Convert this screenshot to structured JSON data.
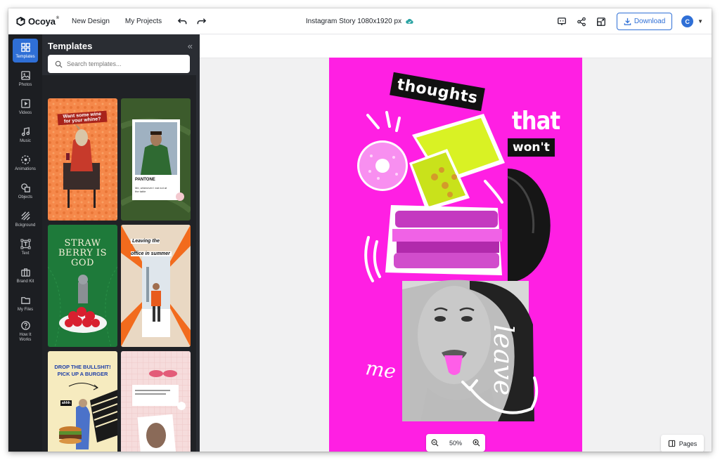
{
  "app": {
    "name": "Ocoya",
    "reg_mark": "®"
  },
  "header": {
    "nav": [
      "New Design",
      "My Projects"
    ],
    "document_title": "Instagram Story 1080x1920 px",
    "download_label": "Download",
    "avatar_initial": "C"
  },
  "rail": {
    "items": [
      {
        "label": "Templates",
        "icon": "templates-icon"
      },
      {
        "label": "Photos",
        "icon": "photos-icon"
      },
      {
        "label": "Videos",
        "icon": "videos-icon"
      },
      {
        "label": "Music",
        "icon": "music-icon"
      },
      {
        "label": "Animations",
        "icon": "animations-icon"
      },
      {
        "label": "Objects",
        "icon": "objects-icon"
      },
      {
        "label": "Bckground",
        "icon": "background-icon"
      },
      {
        "label": "Text",
        "icon": "text-icon"
      },
      {
        "label": "Brand Kit",
        "icon": "brand-kit-icon"
      },
      {
        "label": "My Files",
        "icon": "folder-icon"
      },
      {
        "label": "How It Works",
        "icon": "help-icon"
      }
    ]
  },
  "panel": {
    "title": "Templates",
    "search_placeholder": "Search templates..."
  },
  "templates": [
    {
      "text": "Want some wine for your whine?"
    },
    {
      "text": "PANTONE",
      "subtext": "Me, whenever I eat not at the table"
    },
    {
      "text": "STRAW BERRY IS GOD"
    },
    {
      "text": "Leaving the office in summer"
    },
    {
      "text": "DROP THE BULLSHIT! PICK UP A BURGER",
      "subtext": "ahhh"
    },
    {
      "text": ""
    }
  ],
  "canvas": {
    "words": [
      "thoughts",
      "that",
      "won't",
      "leave",
      "me"
    ]
  },
  "zoom": {
    "level": "50%"
  },
  "pages_label": "Pages",
  "colors": {
    "accent": "#2f6fd6",
    "canvas_bg": "#ff1fe3",
    "rail_bg": "#1c1e22",
    "panel_bg": "#2a2d33"
  }
}
